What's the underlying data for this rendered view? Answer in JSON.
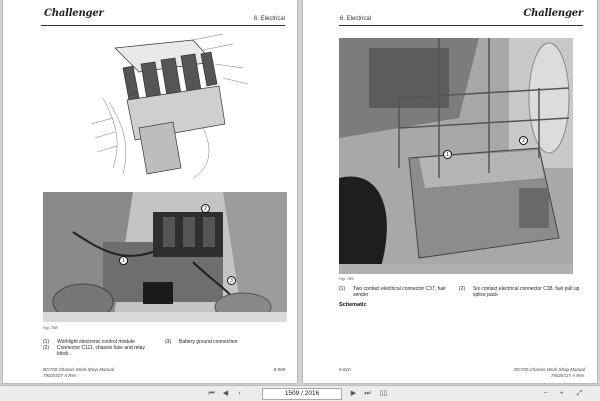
{
  "brand": "Challenger",
  "left_page": {
    "section": "6. Electrical",
    "fig_caption": "Fig. 788",
    "legend": [
      {
        "num": "(1)",
        "text": "Worklight electronic control module"
      },
      {
        "num": "(2)",
        "text": "Connector C111, chassis fuse and relay block"
      },
      {
        "num": "(3)",
        "text": "Battery ground connection"
      }
    ],
    "footer_line1": "RG700 Chassis Work Shop Manual",
    "footer_line2": "79025727 A Rev.",
    "page_number": "6-809",
    "callouts": [
      "1",
      "2",
      "3"
    ]
  },
  "right_page": {
    "section": "6. Electrical",
    "fig_caption": "Fig. 789",
    "legend": [
      {
        "num": "(1)",
        "text": "Two contact electrical connector C37, fuel sender"
      },
      {
        "num": "(2)",
        "text": "Six contact electrical connector C38, fuel pull up splice pack"
      }
    ],
    "heading": "Schematic",
    "footer_line1": "RG700 Chassis Work Shop Manual",
    "footer_line2": "79025727 A Rev.",
    "page_number": "6-810",
    "callouts": [
      "1",
      "2"
    ]
  },
  "toolbar": {
    "current_page": "1509",
    "separator": "/",
    "total_pages": "2016",
    "icons": [
      "first-page-icon",
      "prev-page-icon",
      "next-page-icon",
      "last-page-icon",
      "double-page-icon",
      "single-page-icon",
      "zoom-out-icon",
      "zoom-in-icon",
      "fit-width-icon"
    ]
  }
}
